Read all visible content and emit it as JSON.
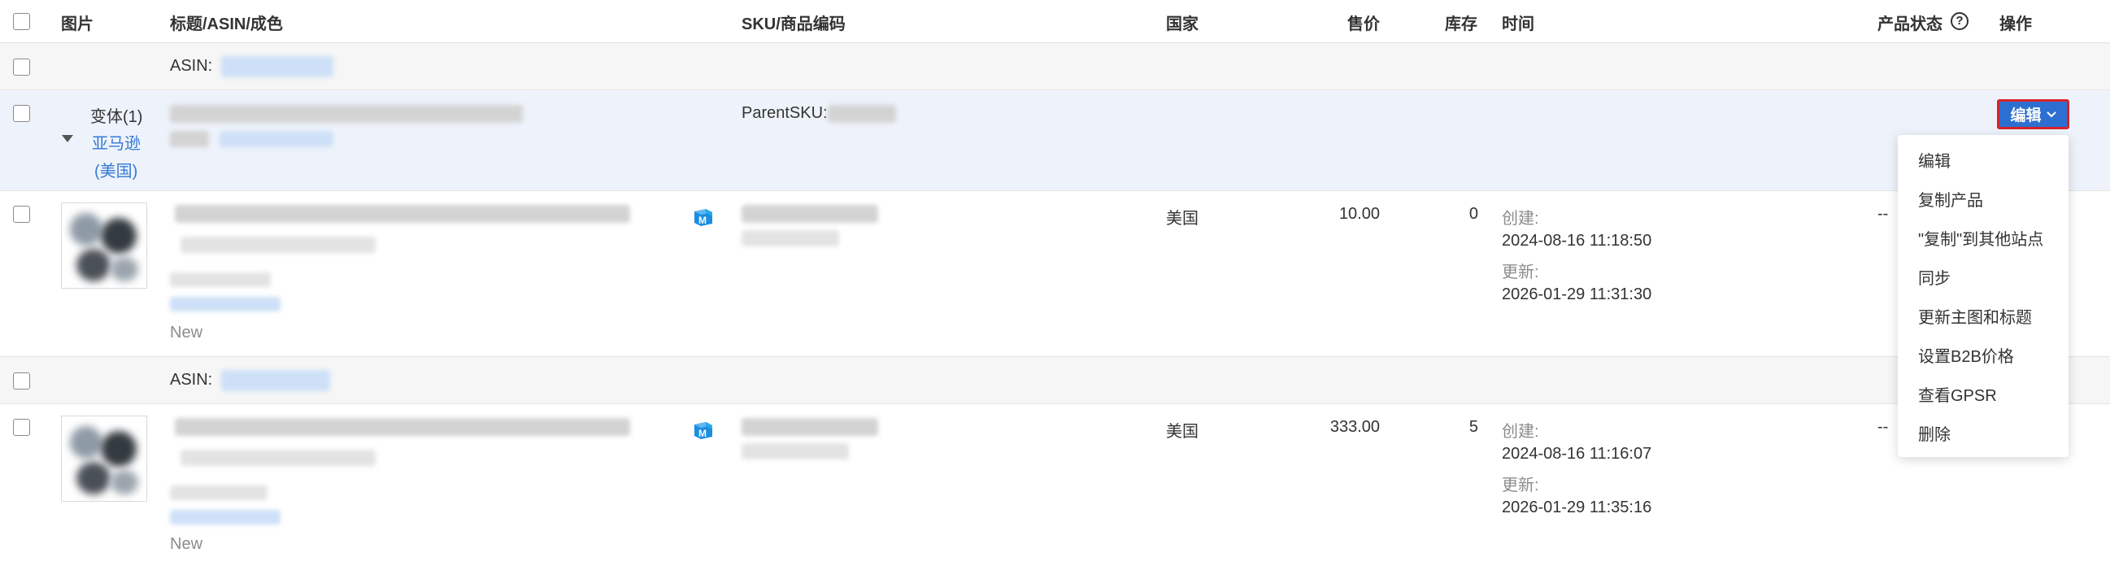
{
  "header": {
    "image": "图片",
    "title_asin_cost": "标题/ASIN/成色",
    "sku_code": "SKU/商品编码",
    "country": "国家",
    "price": "售价",
    "stock": "库存",
    "time": "时间",
    "product_status": "产品状态",
    "help_icon": "?",
    "actions": "操作"
  },
  "groups": [
    {
      "asin_label": "ASIN:"
    },
    {
      "asin_label": "ASIN:"
    }
  ],
  "parent": {
    "variants": "变体(1)",
    "marketplace": "亚马逊",
    "region": "(美国)",
    "parent_sku_label": "ParentSKU:",
    "edit_button": "编辑",
    "chevron_icon": "chevron-down-icon"
  },
  "products": [
    {
      "condition": "New",
      "country": "美国",
      "price": "10.00",
      "stock": "0",
      "created_label": "创建:",
      "created": "2024-08-16 11:18:50",
      "updated_label": "更新:",
      "updated": "2026-01-29 11:31:30",
      "status": "--",
      "badge": "M"
    },
    {
      "condition": "New",
      "country": "美国",
      "price": "333.00",
      "stock": "5",
      "created_label": "创建:",
      "created": "2024-08-16 11:16:07",
      "updated_label": "更新:",
      "updated": "2026-01-29 11:35:16",
      "status": "--",
      "badge": "M"
    }
  ],
  "dropdown": {
    "items": [
      "编辑",
      "复制产品",
      "\"复制\"到其他站点",
      "同步",
      "更新主图和标题",
      "设置B2B价格",
      "查看GPSR",
      "删除"
    ]
  },
  "colors": {
    "accent": "#2d6fd1",
    "highlight_border": "#d8232a",
    "link": "#3578d4",
    "parent_row_bg": "#eef3fb",
    "group_row_bg": "#f6f6f6"
  }
}
